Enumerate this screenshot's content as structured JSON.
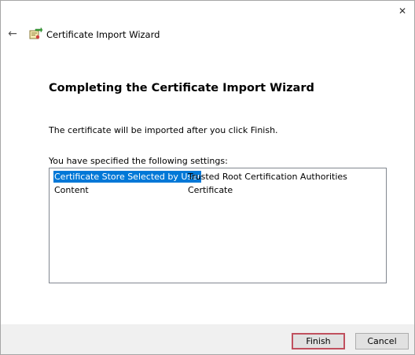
{
  "window": {
    "close_glyph": "✕",
    "title": "Certificate Import Wizard"
  },
  "header": {
    "back_glyph": "←"
  },
  "main": {
    "heading": "Completing the Certificate Import Wizard",
    "intro": "The certificate will be imported after you click Finish.",
    "settings_label": "You have specified the following settings:",
    "settings": [
      {
        "name": "Certificate Store Selected by User",
        "value": "Trusted Root Certification Authorities",
        "selected": true
      },
      {
        "name": "Content",
        "value": "Certificate",
        "selected": false
      }
    ]
  },
  "footer": {
    "finish_label": "Finish",
    "cancel_label": "Cancel"
  },
  "colors": {
    "selection": "#0078d7",
    "finish_border": "#c0505e",
    "footer_bg": "#f0f0f0"
  },
  "icons": [
    "close-icon",
    "back-arrow-icon",
    "certificate-wizard-icon"
  ]
}
